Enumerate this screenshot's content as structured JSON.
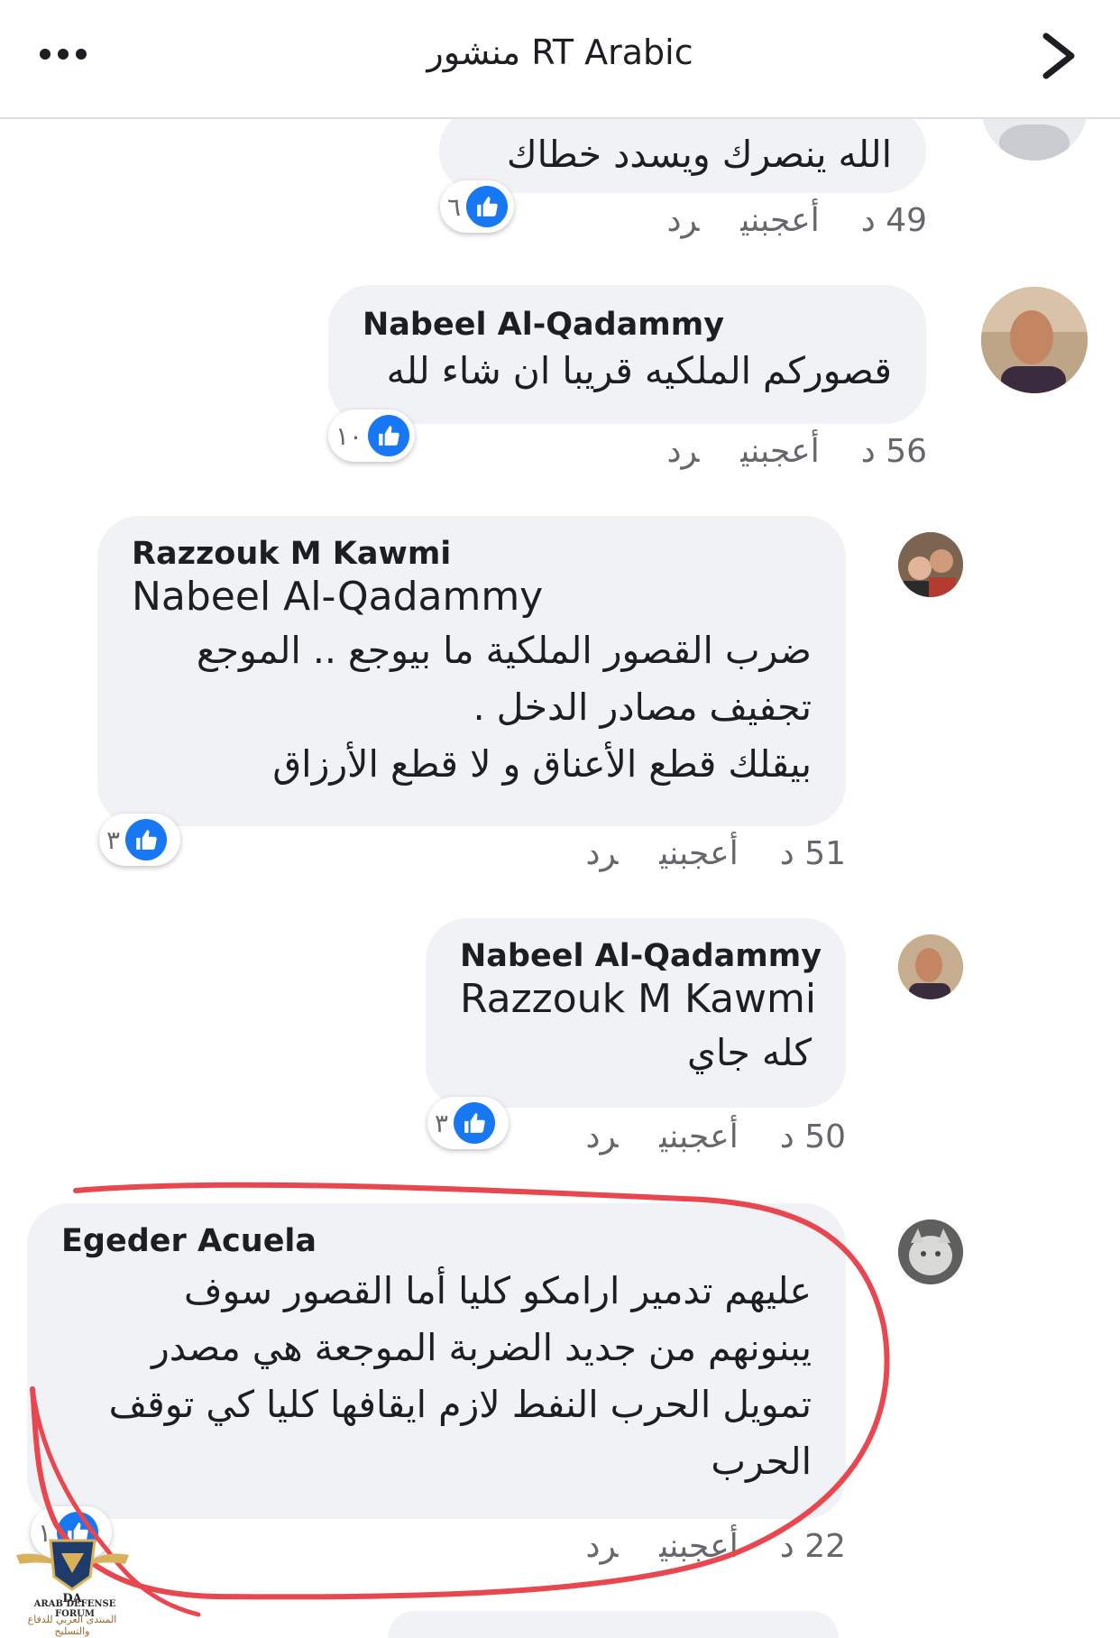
{
  "header": {
    "title": "منشور RT Arabic",
    "more_icon": "more-horizontal-icon",
    "back_icon": "chevron-right-icon"
  },
  "colors": {
    "like_blue": "#1877f2",
    "bubble_bg": "#f0f2f5",
    "annotation_red": "#e8474f"
  },
  "comments": [
    {
      "author": "",
      "text_lines": [
        "الله ينصرك ويسدد خطاك"
      ],
      "time": "49 د",
      "like_label": "أعجبني",
      "reply_label": "رد",
      "reactions": "٦"
    },
    {
      "author": "Nabeel Al-Qadammy",
      "text_lines": [
        "قصوركم الملكيه قريبا ان شاء لله"
      ],
      "time": "56 د",
      "like_label": "أعجبني",
      "reply_label": "رد",
      "reactions": "١٠"
    },
    {
      "author": "Razzouk M Kawmi",
      "tag": "Nabeel Al-Qadammy",
      "text_lines": [
        "ضرب القصور الملكية ما بيوجع .. الموجع",
        "تجفيف مصادر الدخل .",
        "بيقلك قطع الأعناق و لا قطع الأرزاق"
      ],
      "time": "51 د",
      "like_label": "أعجبني",
      "reply_label": "رد",
      "reactions": "٣"
    },
    {
      "author": "Nabeel Al-Qadammy",
      "tag": "Razzouk M Kawmi",
      "text_lines": [
        "كله جاي"
      ],
      "time": "50 د",
      "like_label": "أعجبني",
      "reply_label": "رد",
      "reactions": "٣"
    },
    {
      "author": "Egeder Acuela",
      "text_lines": [
        "عليهم تدمير ارامكو كليا أما القصور سوف",
        "يبنونهم من جديد الضربة الموجعة هي مصدر",
        "تمويل الحرب النفط لازم ايقافها كليا كي توقف",
        "الحرب"
      ],
      "time": "22 د",
      "like_label": "أعجبني",
      "reply_label": "رد",
      "reactions": "١"
    }
  ],
  "watermark": {
    "title": "ARAB DEFENSE FORUM",
    "subtitle": "المنتدى العربي للدفاع والتسليح",
    "initials": "DA"
  }
}
